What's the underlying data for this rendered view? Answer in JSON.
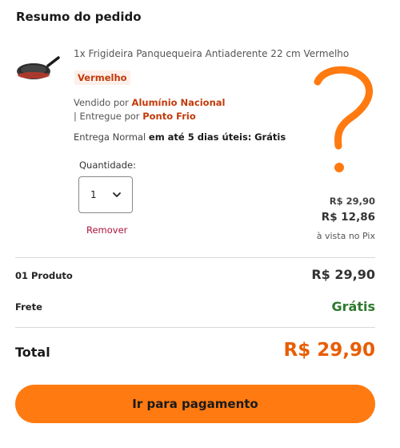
{
  "summary": {
    "title": "Resumo do pedido"
  },
  "product": {
    "name": "1x Frigideira Panquequeira Antiaderente 22 cm Vermelho",
    "variant": "Vermelho",
    "sold_by_label": "Vendido por",
    "sold_by": "Alumínio Nacional",
    "delivered_by_label": "| Entregue por",
    "delivered_by": "Ponto Frio",
    "delivery_type": "Entrega Normal",
    "delivery_time": "em até 5 dias úteis:",
    "delivery_cost": "Grátis",
    "image_icon": "frying-pan-icon"
  },
  "quantity": {
    "label": "Quantidade:",
    "value": "1",
    "remove_label": "Remover"
  },
  "pricing": {
    "original_price": "R$ 29,90",
    "pix_price": "R$ 12,86",
    "pix_note": "à vista no Pix"
  },
  "totals": {
    "products_label": "01 Produto",
    "products_value": "R$ 29,90",
    "shipping_label": "Frete",
    "shipping_value": "Grátis",
    "total_label": "Total",
    "total_value": "R$ 29,90"
  },
  "checkout": {
    "button_label": "Ir para pagamento"
  },
  "colors": {
    "accent": "#ff7a10",
    "total": "#e85d04",
    "seller": "#c23a0a",
    "free": "#2d7a2d",
    "remove": "#b0123a"
  }
}
